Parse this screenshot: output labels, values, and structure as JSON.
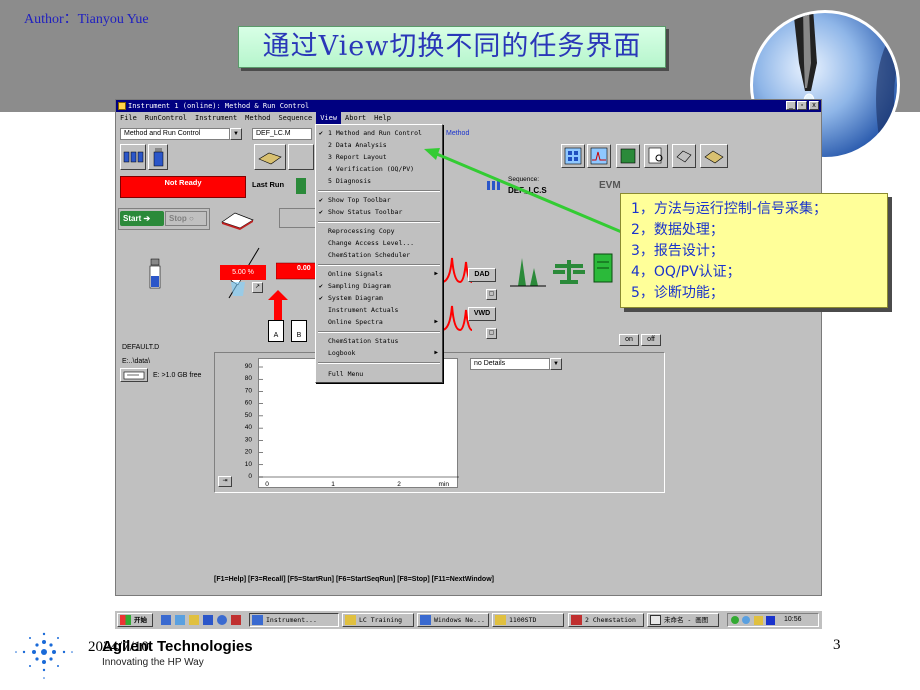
{
  "slide": {
    "author": "Author：Tianyou Yue",
    "title": "通过View切换不同的任务界面",
    "date": "2024/7/10",
    "page_number": "3",
    "brand": {
      "name": "Agilent Technologies",
      "tagline": "Innovating the HP Way"
    }
  },
  "window": {
    "title": "Instrument 1 (online): Method & Run Control",
    "controls": [
      "_",
      "▫",
      "x"
    ],
    "menubar": [
      "File",
      "RunControl",
      "Instrument",
      "Method",
      "Sequence",
      "View",
      "Abort",
      "Help"
    ],
    "view_selector": "Method and Run Control",
    "method_selector": "DEF_LC.M",
    "method_label": "Method",
    "status": {
      "not_ready": "Not Ready",
      "last_run": "Last Run",
      "sequence_label": "Sequence:",
      "sequence_value": "DEF_LC.S"
    },
    "controls_left": {
      "start": "Start",
      "stop": "Stop"
    },
    "datafile": "DEFAULT.D",
    "data_path": "E:..\\data\\",
    "disk_free": "E: >1.0 GB free",
    "pump_flow": "5.00 %",
    "pump_flow_2": "0.00",
    "solvent_a": "A",
    "solvent_b": "B",
    "detectors": {
      "dad": "DAD",
      "vwd": "VWD"
    },
    "on_label": "on",
    "off_label": "off",
    "details_selector": "no Details",
    "plot": {
      "y_ticks": [
        "90",
        "80",
        "70",
        "60",
        "50",
        "40",
        "30",
        "20",
        "10",
        "0"
      ],
      "x_ticks": [
        "0",
        "1",
        "2"
      ],
      "x_unit": "min"
    },
    "hotkeys": "[F1=Help] [F3=Recall] [F5=StartRun] [F6=StartSeqRun] [F8=Stop] [F11=NextWindow]"
  },
  "view_menu": {
    "items": [
      {
        "label": "1 Method and Run Control",
        "checked": true
      },
      {
        "label": "2 Data Analysis",
        "checked": false
      },
      {
        "label": "3 Report Layout",
        "checked": false
      },
      {
        "label": "4 Verification (OQ/PV)",
        "checked": false
      },
      {
        "label": "5 Diagnosis",
        "checked": false
      },
      {
        "label": "Show Top Toolbar",
        "checked": true
      },
      {
        "label": "Show Status Toolbar",
        "checked": true
      },
      {
        "label": "Reprocessing Copy",
        "checked": false
      },
      {
        "label": "Change Access Level...",
        "checked": false
      },
      {
        "label": "ChemStation Scheduler",
        "checked": false
      },
      {
        "label": "Online Signals",
        "checked": false,
        "submenu": true
      },
      {
        "label": "Sampling Diagram",
        "checked": true
      },
      {
        "label": "System Diagram",
        "checked": true
      },
      {
        "label": "Instrument Actuals",
        "checked": false
      },
      {
        "label": "Online Spectra",
        "checked": false,
        "submenu": true
      },
      {
        "label": "ChemStation Status",
        "checked": false
      },
      {
        "label": "Logbook",
        "checked": false,
        "submenu": true
      },
      {
        "label": "Full Menu",
        "checked": false
      }
    ]
  },
  "callout": {
    "lines": [
      "1，方法与运行控制-信号采集；",
      "2，数据处理；",
      "3，报告设计；",
      "4，OQ/PV认证；",
      "5，诊断功能；"
    ]
  },
  "taskbar": {
    "start": "开始",
    "items": [
      "Instrument...",
      "LC Training",
      "Windows Ne...",
      "1100STD",
      "2 Chemstation",
      "未命名 - 画图"
    ],
    "clock": "10:56"
  },
  "colors": {
    "title_text": "#2a37b8",
    "callout_bg": "#ffff99",
    "callout_text": "#1a33cc",
    "arrow": "#33cc33",
    "titlebar": "#000080",
    "not_ready": "#ff0000"
  }
}
